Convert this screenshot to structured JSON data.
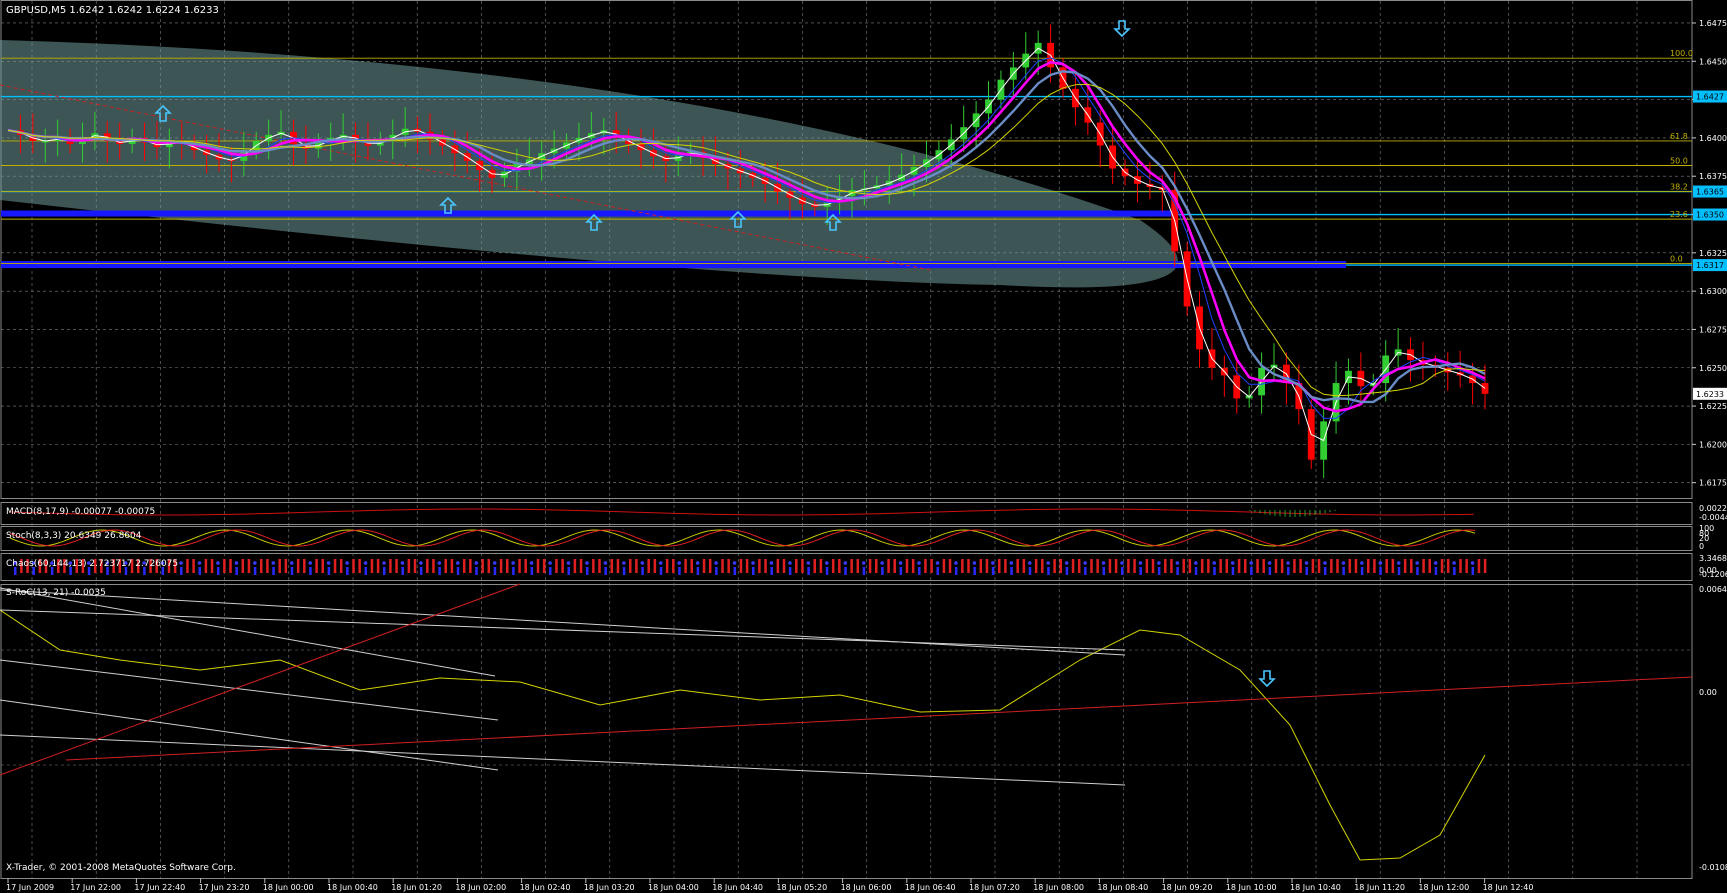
{
  "symbol_header": "GBPUSD,M5  1.6242 1.6242 1.6224 1.6233",
  "copyright": "X-Trader, © 2001-2008 MetaQuotes Software Corp.",
  "colors": {
    "background": "#000000",
    "grid": "#7f7f7f",
    "bull_candle": "#32cd32",
    "bear_candle": "#ff0000",
    "fib": "#c0b000",
    "hline": "#00bfff",
    "ellipse": "#6f9a9a",
    "ma_magenta": "#ff00ff",
    "ma_green": "#00ff00",
    "ma_blue": "#1e40ff",
    "ma_yellow": "#d4d400",
    "ma_steel": "#6a8cc6"
  },
  "price_axis": {
    "ticks": [
      "1.6475",
      "1.6450",
      "1.6425",
      "1.6400",
      "1.6375",
      "1.6350",
      "1.6325",
      "1.6300",
      "1.6275",
      "1.6250",
      "1.6225",
      "1.6200",
      "1.6175"
    ],
    "ylim": [
      1.6165,
      1.649
    ]
  },
  "fib_labels": [
    "100.0",
    "61.8",
    "50.0",
    "38.2",
    "23.6",
    "0.0"
  ],
  "price_flags": [
    "1.6427",
    "1.6365",
    "1.6350",
    "1.6317",
    "1.6233"
  ],
  "time_axis": [
    "17 Jun 2009",
    "17 Jun 22:00",
    "17 Jun 22:40",
    "17 Jun 23:20",
    "18 Jun 00:00",
    "18 Jun 00:40",
    "18 Jun 01:20",
    "18 Jun 02:00",
    "18 Jun 02:40",
    "18 Jun 03:20",
    "18 Jun 04:00",
    "18 Jun 04:40",
    "18 Jun 05:20",
    "18 Jun 06:00",
    "18 Jun 06:40",
    "18 Jun 07:20",
    "18 Jun 08:00",
    "18 Jun 08:40",
    "18 Jun 09:20",
    "18 Jun 10:00",
    "18 Jun 10:40",
    "18 Jun 11:20",
    "18 Jun 12:00",
    "18 Jun 12:40"
  ],
  "macd": {
    "label": "MACD(8,17,9) -0.00077 -0.00075",
    "axis": [
      "0.0022",
      "-0.00448"
    ]
  },
  "stoch": {
    "label": "Stoch(8,3,3) 20.6349 26.8604",
    "axis": [
      "100",
      "80",
      "20",
      "0"
    ]
  },
  "chaos": {
    "label": "Chaos(60,144,13) 2.723717 2.726075",
    "axis": [
      "3.34680",
      "0.00",
      "-0.120695"
    ]
  },
  "sroc": {
    "label": "S-RoC(13, 21) -0.0035",
    "axis": [
      "0.0064",
      "0.00",
      "-0.0108"
    ]
  },
  "chart_data": {
    "type": "candlestick",
    "title": "GBPUSD,M5",
    "ohlc_header": {
      "open": 1.6242,
      "high": 1.6242,
      "low": 1.6224,
      "close": 1.6233
    },
    "ylim": [
      1.6165,
      1.649
    ],
    "x_ticks": [
      "17 Jun 2009",
      "17 Jun 22:00",
      "17 Jun 22:40",
      "17 Jun 23:20",
      "18 Jun 00:00",
      "18 Jun 00:40",
      "18 Jun 01:20",
      "18 Jun 02:00",
      "18 Jun 02:40",
      "18 Jun 03:20",
      "18 Jun 04:00",
      "18 Jun 04:40",
      "18 Jun 05:20",
      "18 Jun 06:00",
      "18 Jun 06:40",
      "18 Jun 07:20",
      "18 Jun 08:00",
      "18 Jun 08:40",
      "18 Jun 09:20",
      "18 Jun 10:00",
      "18 Jun 10:40",
      "18 Jun 11:20",
      "18 Jun 12:00",
      "18 Jun 12:40"
    ],
    "close_path": [
      1.6405,
      1.6402,
      1.6398,
      1.6398,
      1.64,
      1.6396,
      1.64,
      1.6403,
      1.6398,
      1.6396,
      1.64,
      1.6397,
      1.6394,
      1.6398,
      1.6396,
      1.6392,
      1.6389,
      1.6386,
      1.6385,
      1.6392,
      1.6398,
      1.6402,
      1.6404,
      1.6396,
      1.6393,
      1.6397,
      1.64,
      1.6402,
      1.6398,
      1.6395,
      1.6398,
      1.6402,
      1.6406,
      1.6404,
      1.6399,
      1.6395,
      1.639,
      1.6385,
      1.6379,
      1.6374,
      1.6378,
      1.6383,
      1.6386,
      1.639,
      1.6393,
      1.6397,
      1.64,
      1.6403,
      1.6405,
      1.64,
      1.6396,
      1.6392,
      1.6388,
      1.6385,
      1.6389,
      1.6391,
      1.6387,
      1.6383,
      1.638,
      1.6377,
      1.6374,
      1.637,
      1.6365,
      1.6361,
      1.6357,
      1.6355,
      1.6358,
      1.6362,
      1.6366,
      1.6367,
      1.6369,
      1.6372,
      1.6376,
      1.6381,
      1.6386,
      1.6392,
      1.6399,
      1.6407,
      1.6416,
      1.6425,
      1.6438,
      1.6446,
      1.6455,
      1.6462,
      1.6446,
      1.6432,
      1.642,
      1.641,
      1.6395,
      1.638,
      1.6375,
      1.637,
      1.6368,
      1.6366,
      1.6326,
      1.629,
      1.6262,
      1.625,
      1.6245,
      1.623,
      1.6232,
      1.625,
      1.6252,
      1.624,
      1.6223,
      1.619,
      1.6215,
      1.624,
      1.6248,
      1.6238,
      1.624,
      1.6258,
      1.6262,
      1.6255,
      1.6252,
      1.625,
      1.6247,
      1.6245,
      1.624,
      1.6233
    ],
    "fib_levels": [
      {
        "label": "100.0",
        "price": 1.6452
      },
      {
        "label": "61.8",
        "price": 1.6398
      },
      {
        "label": "50.0",
        "price": 1.6382
      },
      {
        "label": "38.2",
        "price": 1.6365
      },
      {
        "label": "23.6",
        "price": 1.6347
      },
      {
        "label": "0.0",
        "price": 1.6318
      }
    ],
    "horizontal_lines": [
      1.6427,
      1.6365,
      1.635,
      1.6317
    ],
    "current_price": 1.6233
  }
}
